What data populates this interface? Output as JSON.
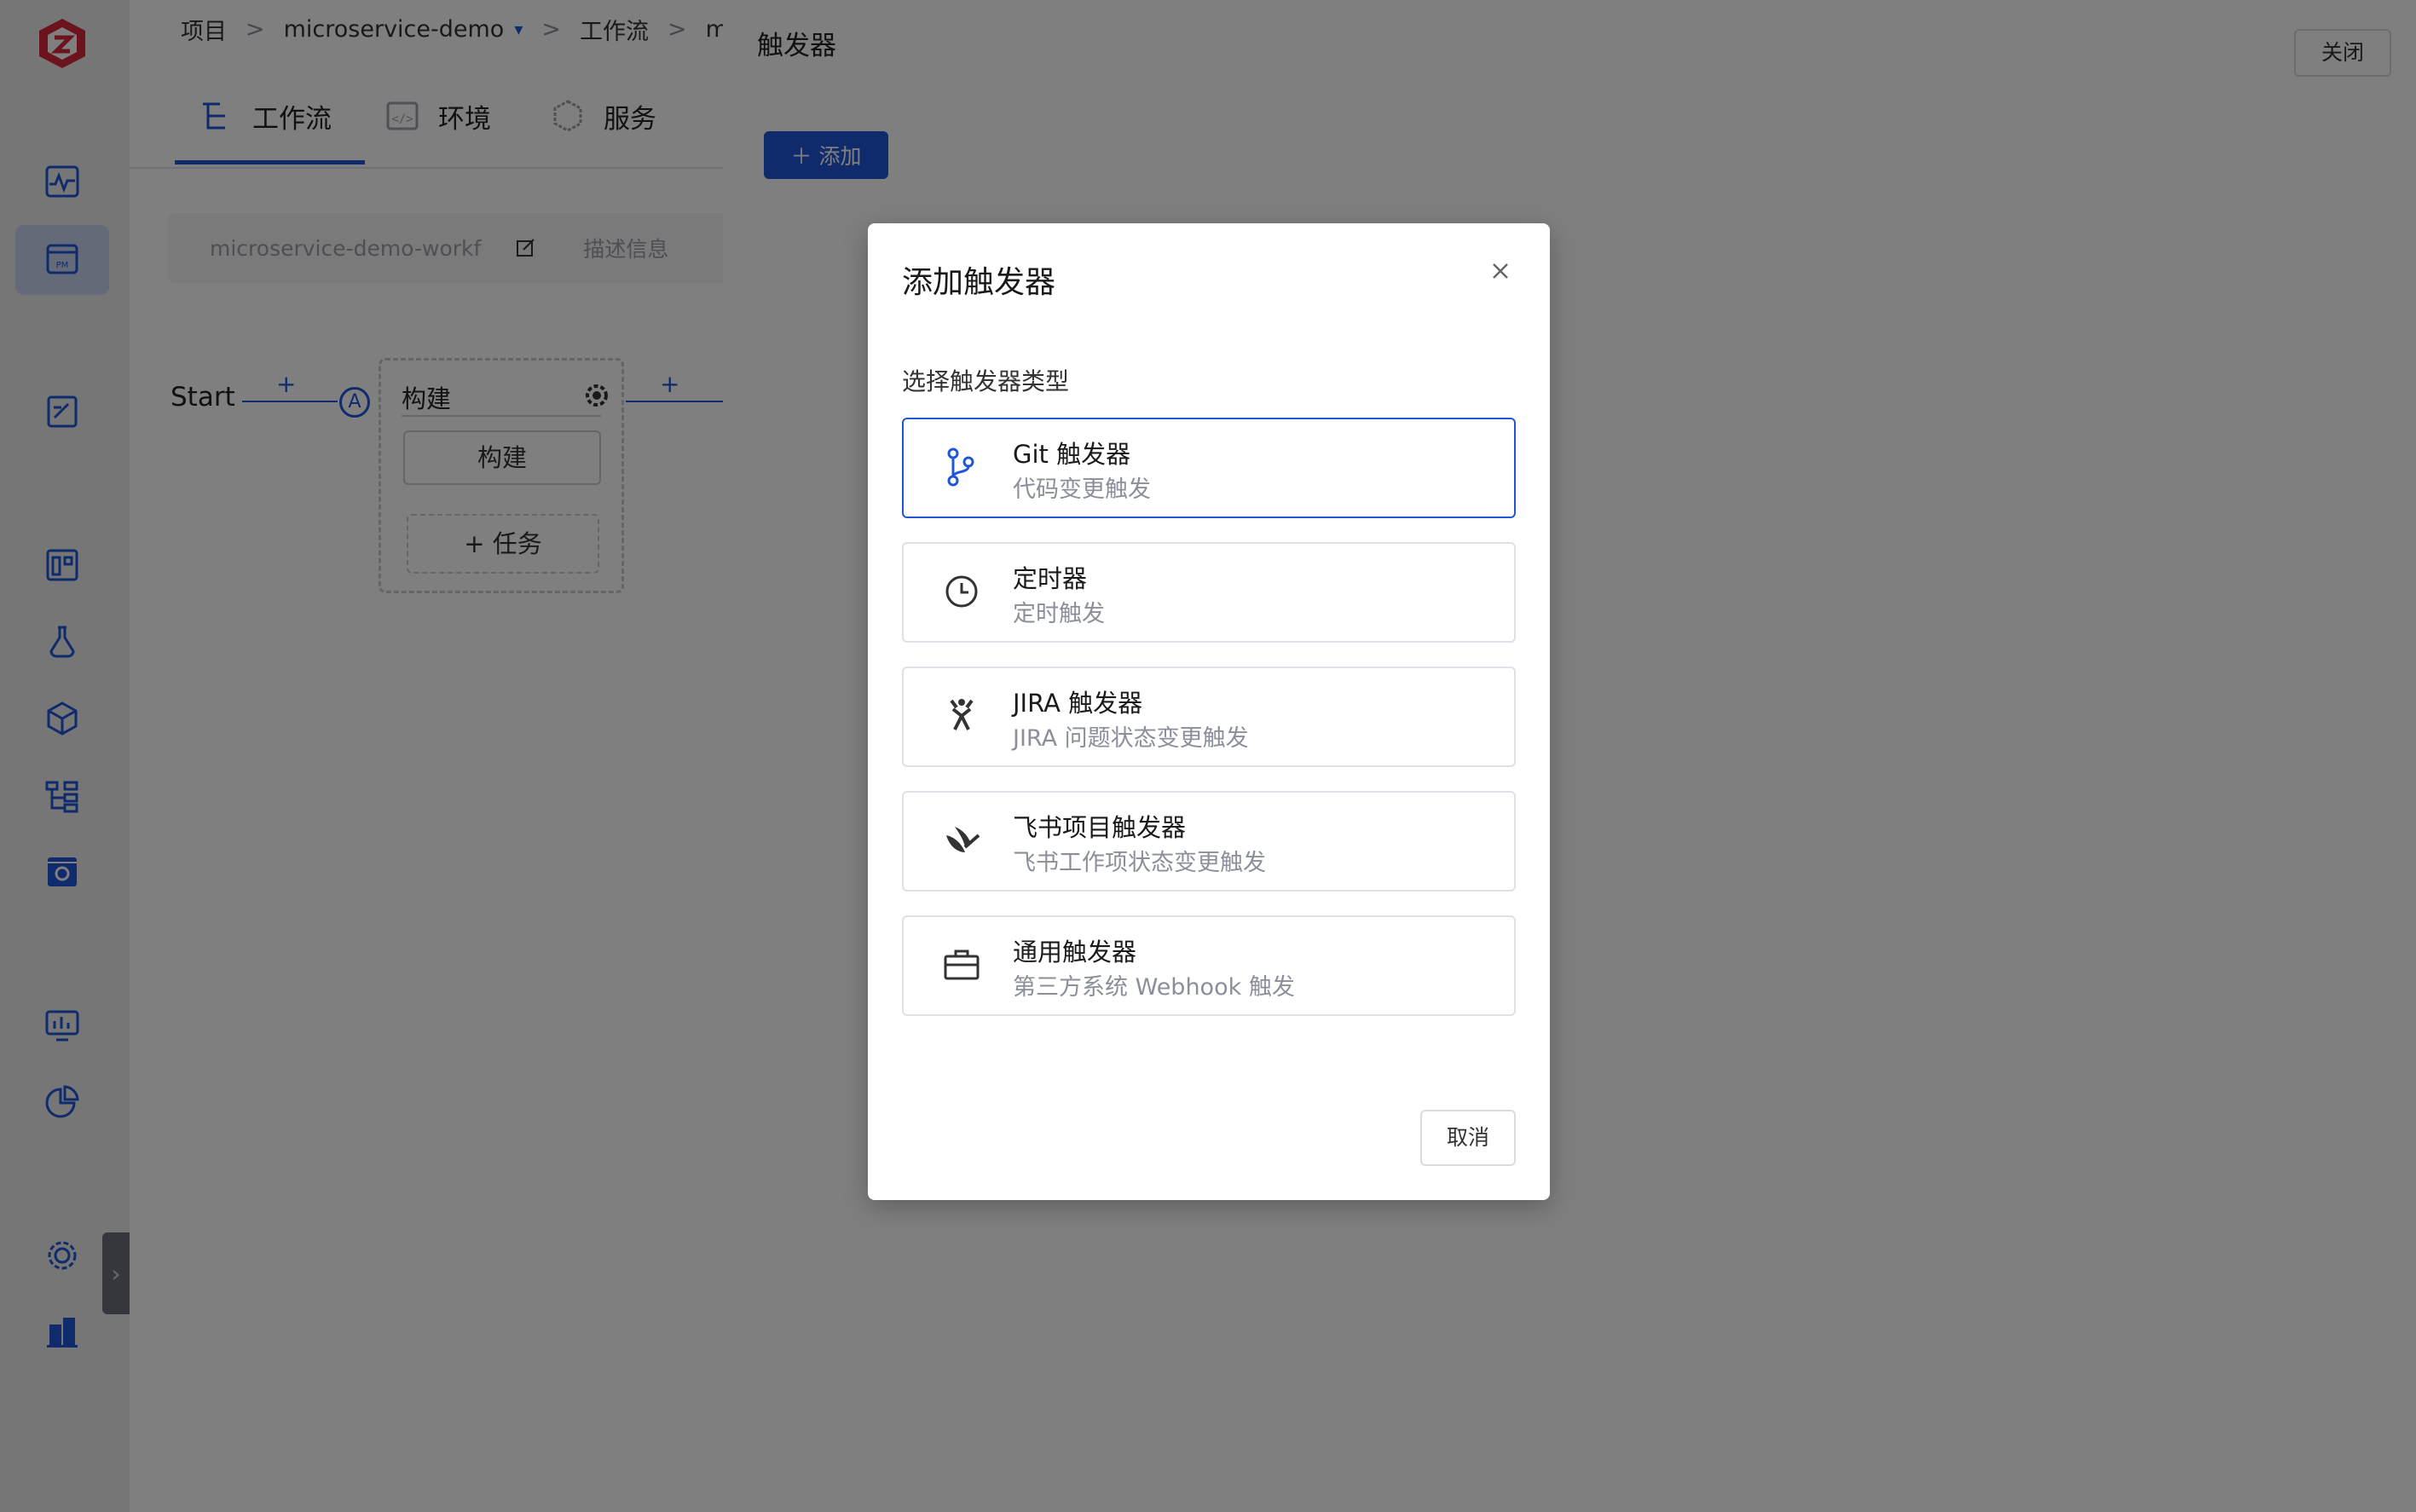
{
  "breadcrumb": {
    "project": "项目",
    "sep1": ">",
    "project_name": "microservice-demo",
    "caret": "▾",
    "sep2": ">",
    "workflow": "工作流",
    "sep3": ">",
    "current": "micr"
  },
  "tabs": {
    "workflow": "工作流",
    "env": "环境",
    "service": "服务"
  },
  "workflow_bar": {
    "name": "microservice-demo-workf",
    "description": "描述信息"
  },
  "canvas": {
    "start": "Start",
    "plus": "+",
    "node_a": "A",
    "stage_title": "构建",
    "job": "构建",
    "add_task": "+ 任务"
  },
  "drawer": {
    "title": "触发器",
    "close": "关闭",
    "add_button": "添加"
  },
  "modal": {
    "title": "添加触发器",
    "subtitle": "选择触发器类型",
    "options": [
      {
        "name": "Git 触发器",
        "desc": "代码变更触发",
        "icon": "git-branch-icon"
      },
      {
        "name": "定时器",
        "desc": "定时触发",
        "icon": "clock-icon"
      },
      {
        "name": "JIRA 触发器",
        "desc": "JIRA 问题状态变更触发",
        "icon": "jira-icon"
      },
      {
        "name": "飞书项目触发器",
        "desc": "飞书工作项状态变更触发",
        "icon": "feishu-icon"
      },
      {
        "name": "通用触发器",
        "desc": "第三方系统 Webhook 触发",
        "icon": "briefcase-icon"
      }
    ],
    "cancel": "取消"
  },
  "colors": {
    "accent": "#1f57d6",
    "logo": "#d9293a",
    "overlay": "rgba(0,0,0,0.5)"
  }
}
